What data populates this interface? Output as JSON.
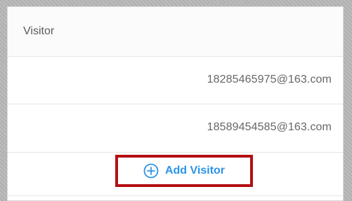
{
  "header": {
    "title": "Visitor"
  },
  "visitors": [
    {
      "email": "18285465975@163.com"
    },
    {
      "email": "18589454585@163.com"
    }
  ],
  "actions": {
    "add_visitor_label": "Add Visitor",
    "add_visitor_icon": "plus-circle-icon",
    "accent_color": "#2b93e8",
    "highlight_color": "#b40f12"
  }
}
